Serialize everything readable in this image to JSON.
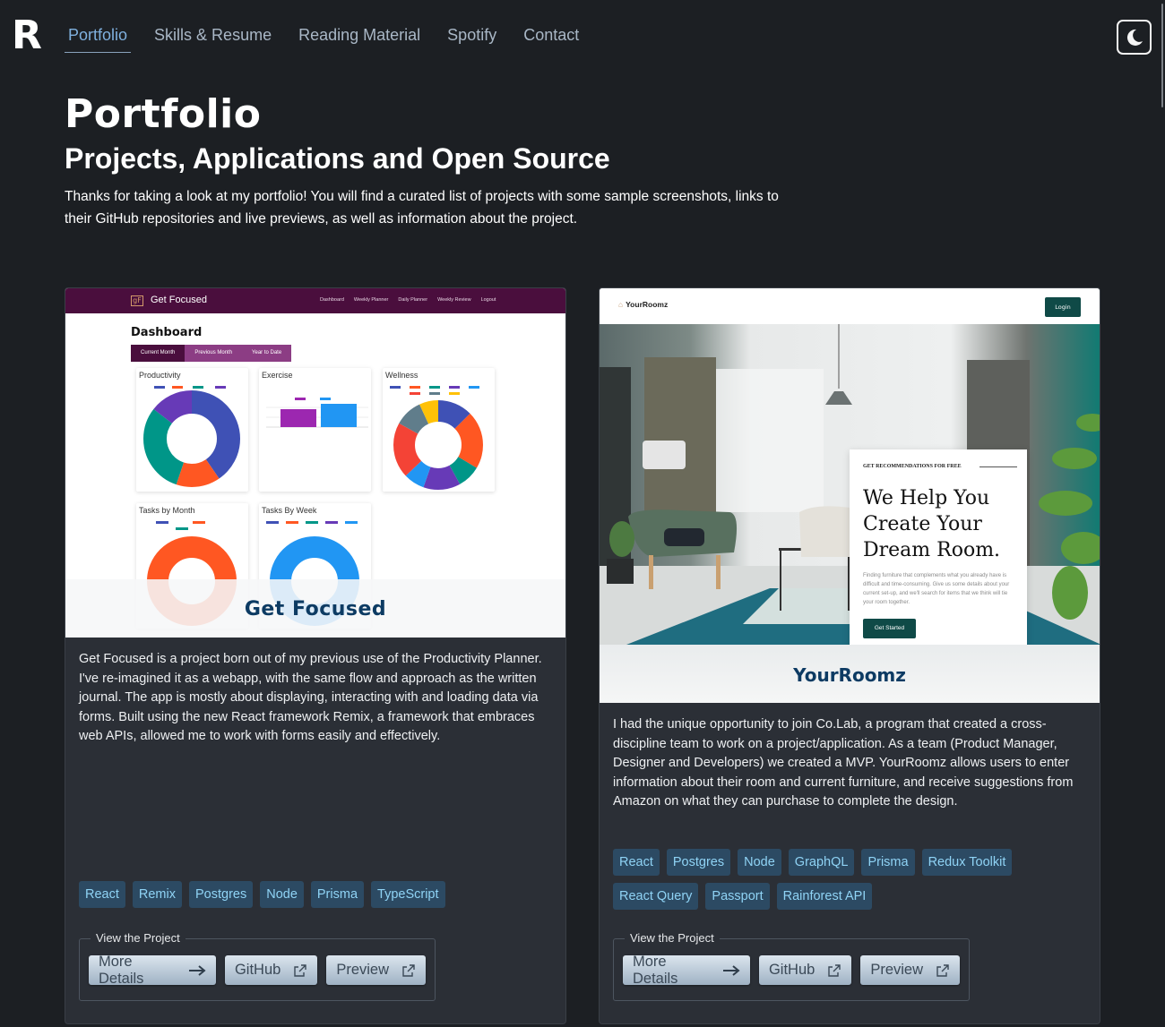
{
  "nav": {
    "logo": "R",
    "links": [
      {
        "label": "Portfolio",
        "active": true
      },
      {
        "label": "Skills & Resume",
        "active": false
      },
      {
        "label": "Reading Material",
        "active": false
      },
      {
        "label": "Spotify",
        "active": false
      },
      {
        "label": "Contact",
        "active": false
      }
    ],
    "theme_toggle_icon": "moon-icon"
  },
  "header": {
    "title": "Portfolio",
    "subtitle": "Projects, Applications and Open Source",
    "intro": "Thanks for taking a look at my portfolio! You will find a curated list of projects with some sample screenshots, links to their GitHub repositories and live previews, as well as information about the project."
  },
  "projects": [
    {
      "name": "Get Focused",
      "screenshot": {
        "brand": "Get Focused",
        "logo_text": "gF",
        "nav_links": [
          "Dashboard",
          "Weekly Planner",
          "Daily Planner",
          "Weekly Review",
          "Logout"
        ],
        "heading": "Dashboard",
        "tabs": [
          "Current Month",
          "Previous Month",
          "Year to Date"
        ],
        "panels": [
          "Productivity",
          "Exercise",
          "Wellness",
          "Tasks by Month",
          "Tasks By Week"
        ],
        "caption": "Get Focused"
      },
      "description": "Get Focused is a project born out of my previous use of the Productivity Planner. I've re-imagined it as a webapp, with the same flow and approach as the written journal. The app is mostly about displaying, interacting with and loading data via forms. Built using the new React framework Remix, a framework that embraces web APIs, allowed me to work with forms easily and effectively.",
      "tags": [
        "React",
        "Remix",
        "Postgres",
        "Node",
        "Prisma",
        "TypeScript"
      ],
      "links_legend": "View the Project",
      "buttons": {
        "details": "More Details",
        "github": "GitHub",
        "preview": "Preview"
      }
    },
    {
      "name": "YourRoomz",
      "screenshot": {
        "brand": "YourRoomz",
        "login": "Login",
        "eyebrow": "GET RECOMMENDATIONS FOR FREE",
        "headline": "We Help You Create Your Dream Room.",
        "description": "Finding furniture that complements what you already have is difficult and time-consuming. Give us some details about your current set-up, and we'll search for items that we think will tie your room together.",
        "cta": "Get Started",
        "caption": "YourRoomz"
      },
      "description": "I had the unique opportunity to join Co.Lab, a program that created a cross-discipline team to work on a project/application. As a team (Product Manager, Designer and Developers) we created a MVP. YourRoomz allows users to enter information about their room and current furniture, and receive suggestions from Amazon on what they can purchase to complete the design.",
      "tags": [
        "React",
        "Postgres",
        "Node",
        "GraphQL",
        "Prisma",
        "Redux Toolkit",
        "React Query",
        "Passport",
        "Rainforest API"
      ],
      "links_legend": "View the Project",
      "buttons": {
        "details": "More Details",
        "github": "GitHub",
        "preview": "Preview"
      }
    }
  ],
  "colors": {
    "background": "#1c1f23",
    "card": "#2b2f36",
    "active_link": "#7fb0de",
    "tag_bg": "#2c4a63",
    "tag_text": "#8fd3f5"
  }
}
